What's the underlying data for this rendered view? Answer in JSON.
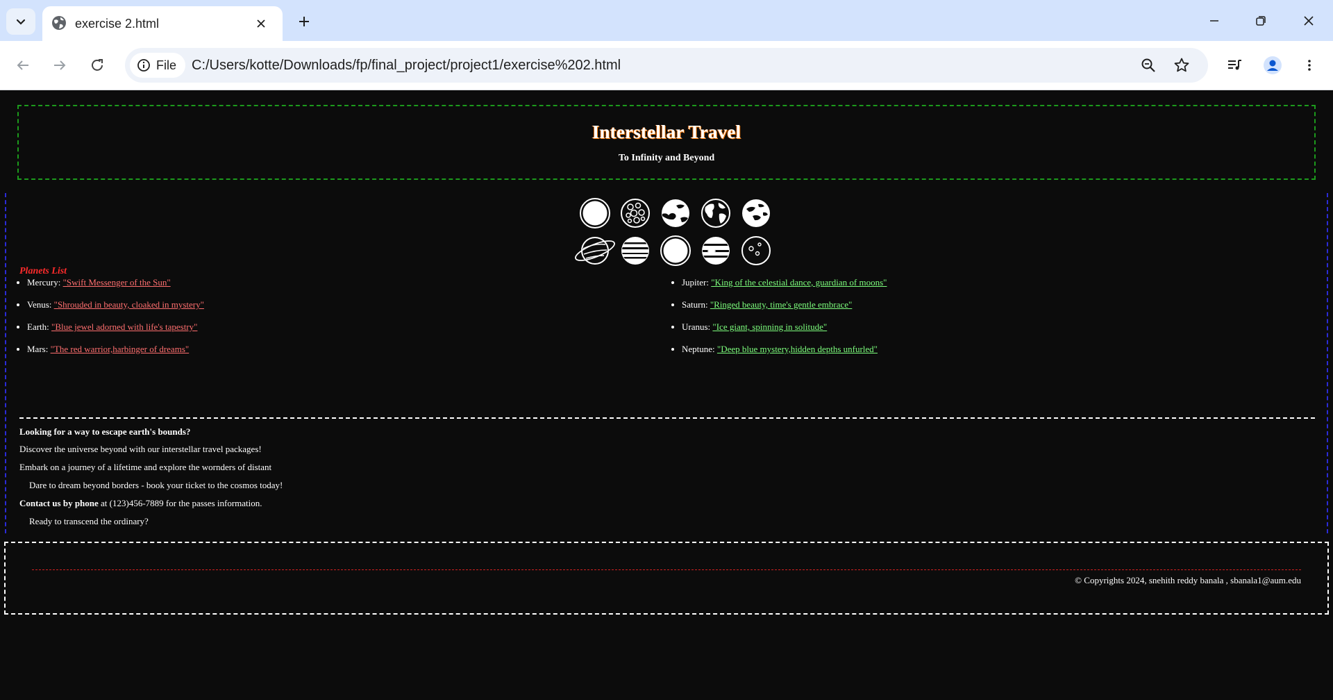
{
  "browser": {
    "tab_title": "exercise 2.html",
    "chip_label": "File",
    "url": "C:/Users/kotte/Downloads/fp/final_project/project1/exercise%202.html"
  },
  "header": {
    "title": "Interstellar Travel",
    "subtitle": "To Infinity and Beyond"
  },
  "planets": {
    "list_title": "Planets List",
    "left": [
      {
        "name": "Mercury:",
        "tagline": "\"Swift Messenger of the Sun\""
      },
      {
        "name": "Venus:",
        "tagline": "\"Shrouded in beauty, cloaked in mystery\""
      },
      {
        "name": "Earth:",
        "tagline": "\"Blue jewel adorned with life's tapestry\""
      },
      {
        "name": "Mars:",
        "tagline": "\"The red warrior,harbinger of dreams\""
      }
    ],
    "right": [
      {
        "name": "Jupiter:",
        "tagline": "\"King of the celestial dance, guardian of moons\""
      },
      {
        "name": "Saturn:",
        "tagline": "\"Ringed beauty, time's gentle embrace\""
      },
      {
        "name": "Uranus:",
        "tagline": "\"Ice giant, spinning in solitude\""
      },
      {
        "name": "Neptune:",
        "tagline": "\"Deep blue mystery,hidden depths unfurled\""
      }
    ],
    "icons": [
      "sun-icon",
      "mercury-icon",
      "venus-icon",
      "earth-icon",
      "mars-icon",
      "saturn-icon",
      "jupiter-icon",
      "moon-icon",
      "neptune-icon",
      "pluto-icon"
    ]
  },
  "content": {
    "heading": "Looking for a way to escape earth's bounds?",
    "line1": "Discover the universe beyond with our interstellar travel packages!",
    "line2": "Embark on a journey of a lifetime and explore the wornders of distant",
    "line3": "Dare to dream beyond borders - book your ticket to the cosmos today!",
    "contact_bold": "Contact us by phone",
    "contact_rest": " at (123)456-7889 for the passes information.",
    "line5": "Ready to transcend the ordinary?"
  },
  "footer": {
    "copyright": "© Copyrights 2024, snehith reddy banala , sbanala1@aum.edu"
  }
}
